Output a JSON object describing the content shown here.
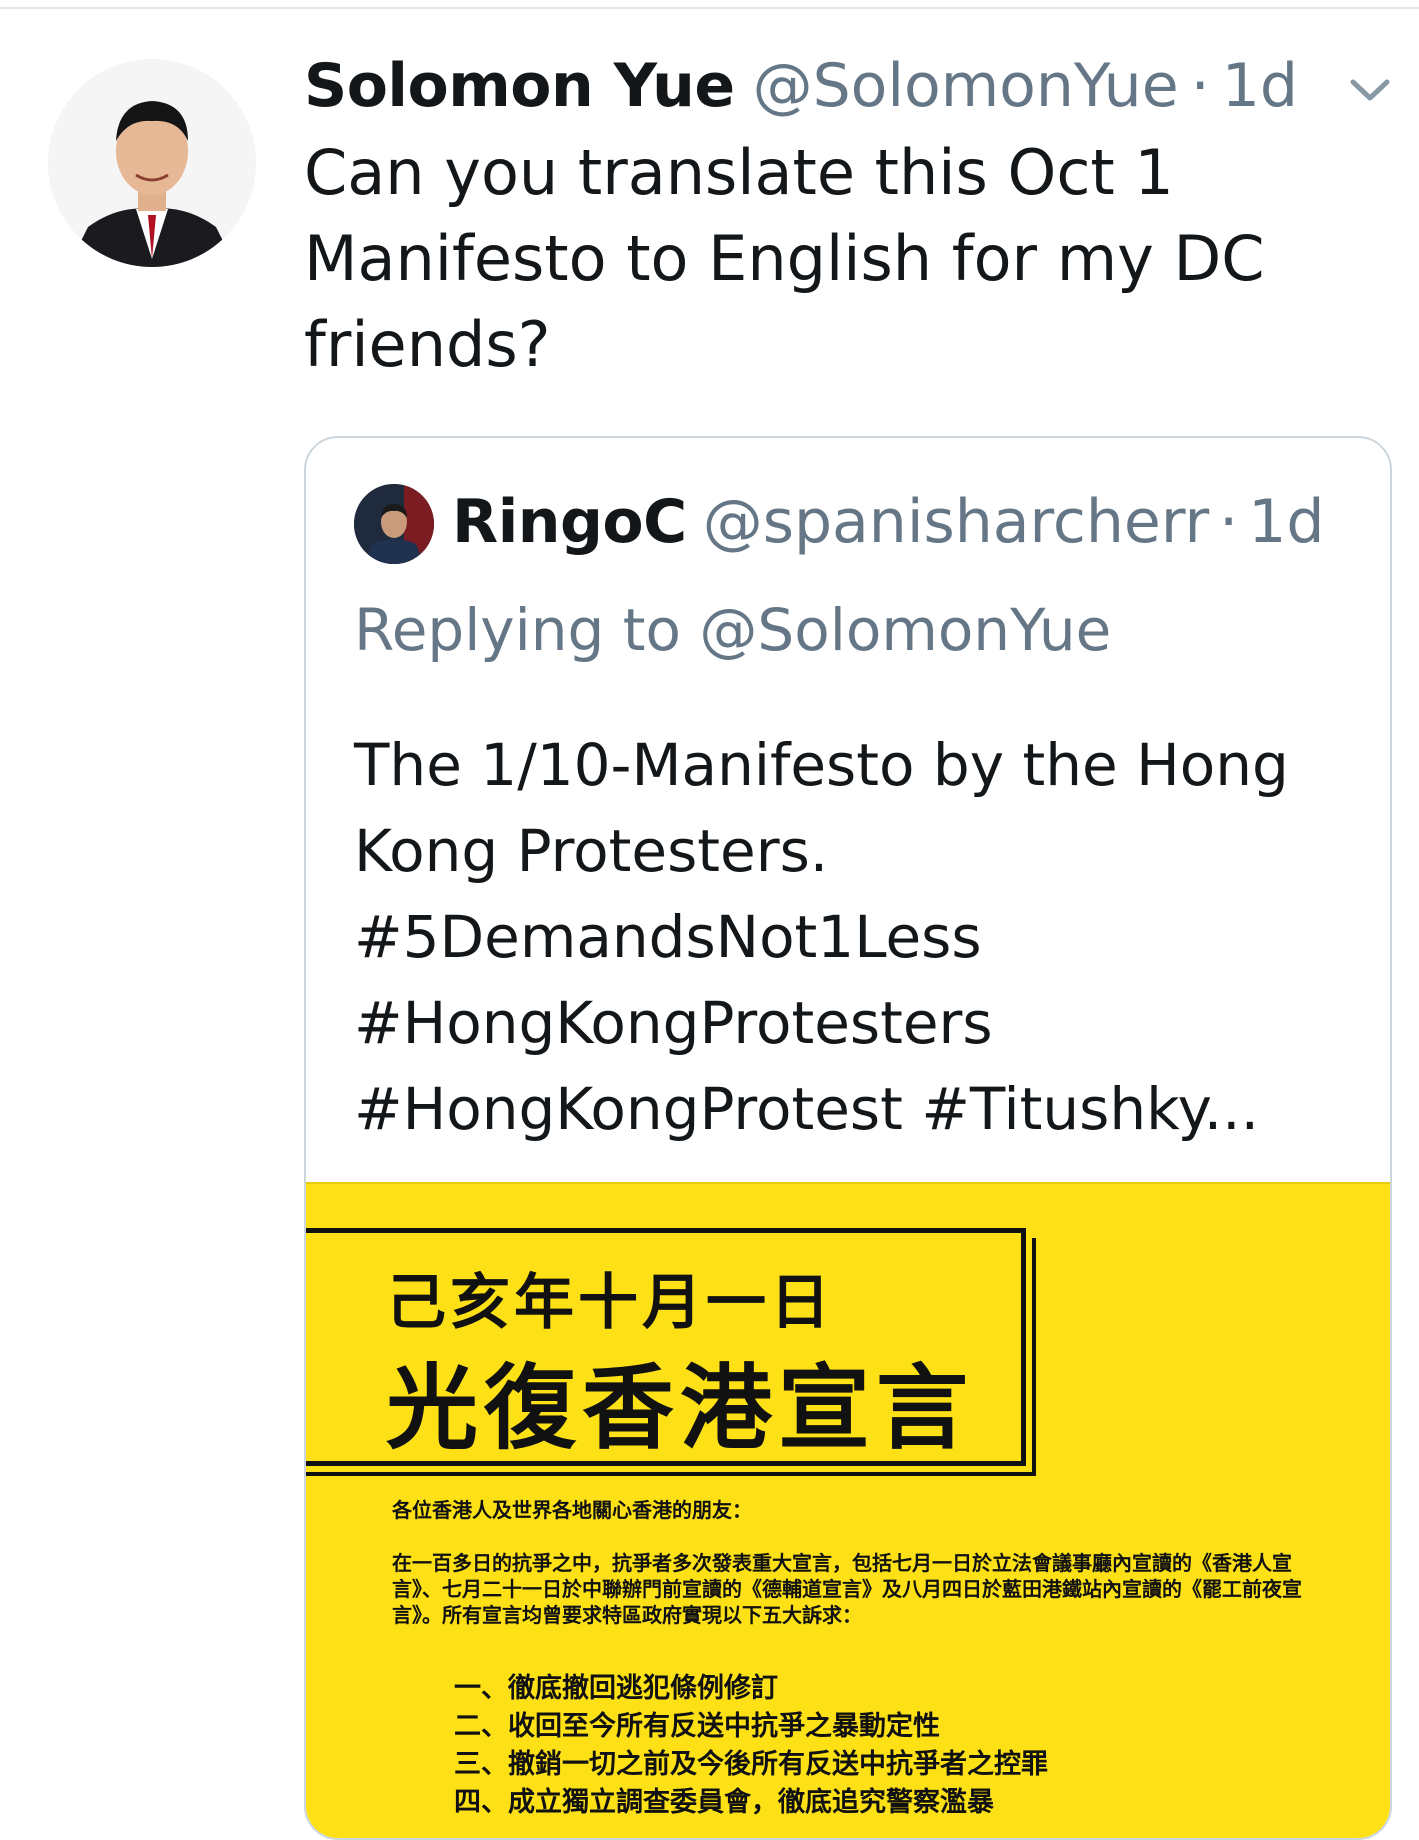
{
  "tweet": {
    "author_name": "Solomon Yue",
    "author_handle": "@SolomonYue",
    "separator": "·",
    "time": "1d",
    "text": "Can you translate this Oct 1 Manifesto to English for my DC friends?"
  },
  "quoted_tweet": {
    "author_name": "RingoC",
    "author_handle": "@spanisharcherr",
    "separator": "·",
    "time": "1d",
    "replying_to": "Replying to @SolomonYue",
    "text_lines": [
      "The 1/10-Manifesto by the Hong",
      "Kong Protesters.",
      "#5DemandsNot1Less",
      "#HongKongProtesters",
      "#HongKongProtest #Titushky..."
    ],
    "image": {
      "background_color": "#fde116",
      "title_line_1": "己亥年十月一日",
      "title_line_2": "光復香港宣言",
      "greeting": "各位香港人及世界各地關心香港的朋友：",
      "paragraph": "在一百多日的抗爭之中，抗爭者多次發表重大宣言，包括七月一日於立法會議事廳內宣讀的《香港人宣言》、七月二十一日於中聯辦門前宣讀的《德輔道宣言》及八月四日於藍田港鐵站內宣讀的《罷工前夜宣言》。所有宣言均曾要求特區政府實現以下五大訴求：",
      "demands": [
        "一、徹底撤回逃犯條例修訂",
        "二、收回至今所有反送中抗爭之暴動定性",
        "三、撤銷一切之前及今後所有反送中抗爭者之控罪",
        "四、成立獨立調查委員會，徹底追究警察濫暴"
      ]
    }
  },
  "icons": {
    "menu": "chevron-down-icon"
  },
  "colors": {
    "primary_text": "#14171a",
    "secondary_text": "#657786",
    "border": "#ccd6dd"
  }
}
